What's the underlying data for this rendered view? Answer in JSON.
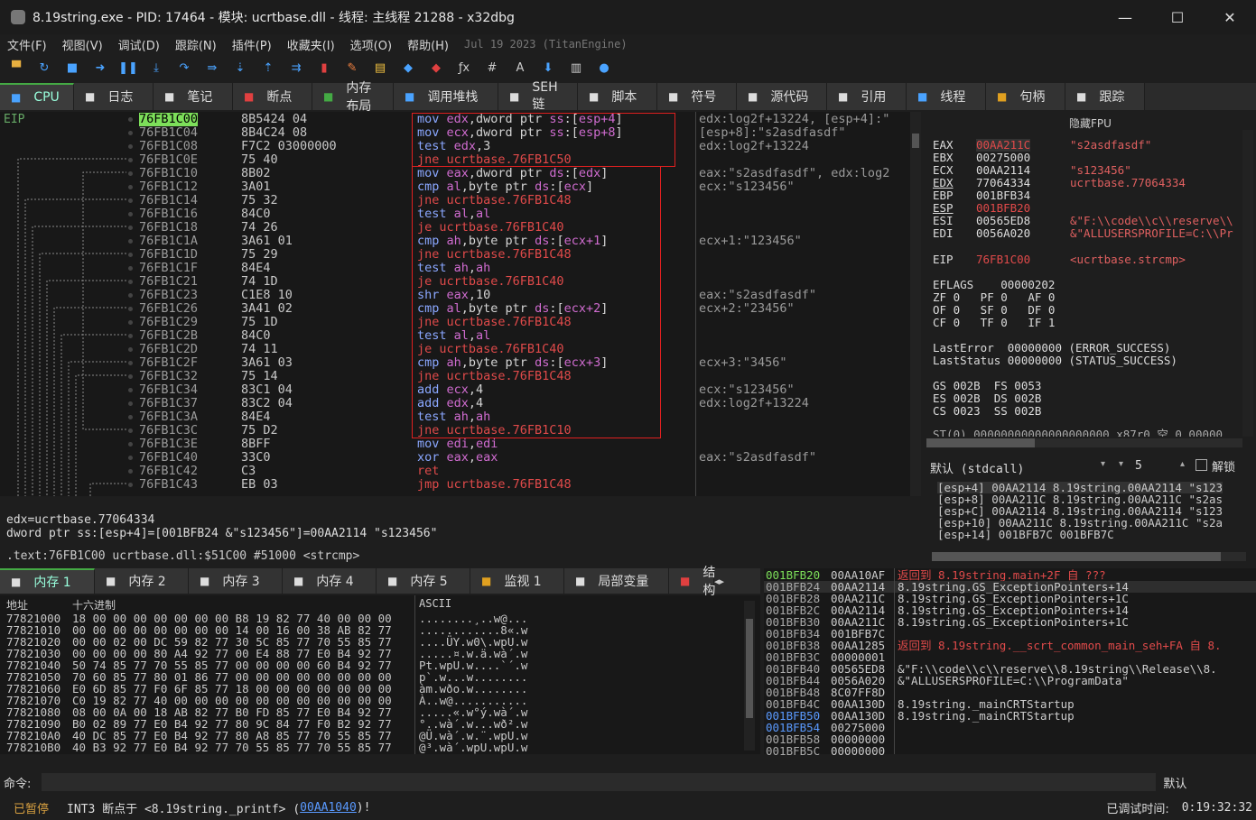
{
  "window": {
    "title": "8.19string.exe - PID: 17464 - 模块: ucrtbase.dll - 线程: 主线程 21288 - x32dbg"
  },
  "menu": [
    "文件(F)",
    "视图(V)",
    "调试(D)",
    "跟踪(N)",
    "插件(P)",
    "收藏夹(I)",
    "选项(O)",
    "帮助(H)"
  ],
  "menu_date": "Jul 19 2023 (TitanEngine)",
  "tabs": [
    "CPU",
    "日志",
    "笔记",
    "断点",
    "内存布局",
    "调用堆栈",
    "SEH链",
    "脚本",
    "符号",
    "源代码",
    "引用",
    "线程",
    "句柄",
    "跟踪"
  ],
  "tab_icons": [
    "cpu-icon",
    "log-icon",
    "notes-icon",
    "breakpoint-icon",
    "memory-map-icon",
    "callstack-icon",
    "seh-icon",
    "script-icon",
    "symbols-icon",
    "source-icon",
    "references-icon",
    "threads-icon",
    "handles-icon",
    "trace-icon"
  ],
  "cpu": {
    "eip_label": "EIP",
    "rows": [
      {
        "addr": "76FB1C00",
        "bytes": "8B5424 04",
        "asm": [
          [
            "kw",
            "mov "
          ],
          [
            "rg",
            "edx"
          ],
          [
            "",
            ","
          ],
          [
            "",
            "dword ptr "
          ],
          [
            "seg",
            "ss"
          ],
          [
            "",
            ":["
          ],
          [
            "rg",
            "esp+4"
          ],
          [
            "",
            "]"
          ]
        ],
        "cmt": "edx:log2f+13224, [esp+4]:\""
      },
      {
        "addr": "76FB1C04",
        "bytes": "8B4C24 08",
        "asm": [
          [
            "kw",
            "mov "
          ],
          [
            "rg",
            "ecx"
          ],
          [
            "",
            ",dword ptr "
          ],
          [
            "seg",
            "ss"
          ],
          [
            "",
            ":["
          ],
          [
            "rg",
            "esp+8"
          ],
          [
            "",
            "]"
          ]
        ],
        "cmt": "[esp+8]:\"s2asdfasdf\""
      },
      {
        "addr": "76FB1C08",
        "bytes": "F7C2 03000000",
        "asm": [
          [
            "kw",
            "test "
          ],
          [
            "rg",
            "edx"
          ],
          [
            "",
            ",3"
          ]
        ],
        "cmt": "edx:log2f+13224"
      },
      {
        "addr": "76FB1C0E",
        "bytes": "75 40",
        "asm": [
          [
            "jmp",
            "jne ucrtbase.76FB1C50"
          ]
        ],
        "cmt": ""
      },
      {
        "addr": "76FB1C10",
        "bytes": "8B02",
        "asm": [
          [
            "kw",
            "mov "
          ],
          [
            "rg",
            "eax"
          ],
          [
            "",
            ",dword ptr "
          ],
          [
            "seg",
            "ds"
          ],
          [
            "",
            ":["
          ],
          [
            "rg",
            "edx"
          ],
          [
            "",
            "]"
          ]
        ],
        "cmt": "eax:\"s2asdfasdf\", edx:log2"
      },
      {
        "addr": "76FB1C12",
        "bytes": "3A01",
        "asm": [
          [
            "kw",
            "cmp "
          ],
          [
            "rg",
            "al"
          ],
          [
            "",
            ",byte ptr "
          ],
          [
            "seg",
            "ds"
          ],
          [
            "",
            ":["
          ],
          [
            "rg",
            "ecx"
          ],
          [
            "",
            "]"
          ]
        ],
        "cmt": "ecx:\"s123456\""
      },
      {
        "addr": "76FB1C14",
        "bytes": "75 32",
        "asm": [
          [
            "jmp",
            "jne ucrtbase.76FB1C48"
          ]
        ],
        "cmt": ""
      },
      {
        "addr": "76FB1C16",
        "bytes": "84C0",
        "asm": [
          [
            "kw",
            "test "
          ],
          [
            "rg",
            "al"
          ],
          [
            "",
            ","
          ],
          [
            "rg",
            "al"
          ]
        ],
        "cmt": ""
      },
      {
        "addr": "76FB1C18",
        "bytes": "74 26",
        "asm": [
          [
            "jmp",
            "je ucrtbase.76FB1C40"
          ]
        ],
        "cmt": ""
      },
      {
        "addr": "76FB1C1A",
        "bytes": "3A61 01",
        "asm": [
          [
            "kw",
            "cmp "
          ],
          [
            "rg",
            "ah"
          ],
          [
            "",
            ",byte ptr "
          ],
          [
            "seg",
            "ds"
          ],
          [
            "",
            ":["
          ],
          [
            "rg",
            "ecx+1"
          ],
          [
            "",
            "]"
          ]
        ],
        "cmt": "ecx+1:\"123456\""
      },
      {
        "addr": "76FB1C1D",
        "bytes": "75 29",
        "asm": [
          [
            "jmp",
            "jne ucrtbase.76FB1C48"
          ]
        ],
        "cmt": ""
      },
      {
        "addr": "76FB1C1F",
        "bytes": "84E4",
        "asm": [
          [
            "kw",
            "test "
          ],
          [
            "rg",
            "ah"
          ],
          [
            "",
            ","
          ],
          [
            "rg",
            "ah"
          ]
        ],
        "cmt": ""
      },
      {
        "addr": "76FB1C21",
        "bytes": "74 1D",
        "asm": [
          [
            "jmp",
            "je ucrtbase.76FB1C40"
          ]
        ],
        "cmt": ""
      },
      {
        "addr": "76FB1C23",
        "bytes": "C1E8 10",
        "asm": [
          [
            "kw",
            "shr "
          ],
          [
            "rg",
            "eax"
          ],
          [
            "",
            ",10"
          ]
        ],
        "cmt": "eax:\"s2asdfasdf\""
      },
      {
        "addr": "76FB1C26",
        "bytes": "3A41 02",
        "asm": [
          [
            "kw",
            "cmp "
          ],
          [
            "rg",
            "al"
          ],
          [
            "",
            ",byte ptr "
          ],
          [
            "seg",
            "ds"
          ],
          [
            "",
            ":["
          ],
          [
            "rg",
            "ecx+2"
          ],
          [
            "",
            "]"
          ]
        ],
        "cmt": "ecx+2:\"23456\""
      },
      {
        "addr": "76FB1C29",
        "bytes": "75 1D",
        "asm": [
          [
            "jmp",
            "jne ucrtbase.76FB1C48"
          ]
        ],
        "cmt": ""
      },
      {
        "addr": "76FB1C2B",
        "bytes": "84C0",
        "asm": [
          [
            "kw",
            "test "
          ],
          [
            "rg",
            "al"
          ],
          [
            "",
            ","
          ],
          [
            "rg",
            "al"
          ]
        ],
        "cmt": ""
      },
      {
        "addr": "76FB1C2D",
        "bytes": "74 11",
        "asm": [
          [
            "jmp",
            "je ucrtbase.76FB1C40"
          ]
        ],
        "cmt": ""
      },
      {
        "addr": "76FB1C2F",
        "bytes": "3A61 03",
        "asm": [
          [
            "kw",
            "cmp "
          ],
          [
            "rg",
            "ah"
          ],
          [
            "",
            ",byte ptr "
          ],
          [
            "seg",
            "ds"
          ],
          [
            "",
            ":["
          ],
          [
            "rg",
            "ecx+3"
          ],
          [
            "",
            "]"
          ]
        ],
        "cmt": "ecx+3:\"3456\""
      },
      {
        "addr": "76FB1C32",
        "bytes": "75 14",
        "asm": [
          [
            "jmp",
            "jne ucrtbase.76FB1C48"
          ]
        ],
        "cmt": ""
      },
      {
        "addr": "76FB1C34",
        "bytes": "83C1 04",
        "asm": [
          [
            "kw",
            "add "
          ],
          [
            "rg",
            "ecx"
          ],
          [
            "",
            ",4"
          ]
        ],
        "cmt": "ecx:\"s123456\""
      },
      {
        "addr": "76FB1C37",
        "bytes": "83C2 04",
        "asm": [
          [
            "kw",
            "add "
          ],
          [
            "rg",
            "edx"
          ],
          [
            "",
            ",4"
          ]
        ],
        "cmt": "edx:log2f+13224"
      },
      {
        "addr": "76FB1C3A",
        "bytes": "84E4",
        "asm": [
          [
            "kw",
            "test "
          ],
          [
            "rg",
            "ah"
          ],
          [
            "",
            ","
          ],
          [
            "rg",
            "ah"
          ]
        ],
        "cmt": ""
      },
      {
        "addr": "76FB1C3C",
        "bytes": "75 D2",
        "asm": [
          [
            "jmp",
            "jne ucrtbase.76FB1C10"
          ]
        ],
        "cmt": ""
      },
      {
        "addr": "76FB1C3E",
        "bytes": "8BFF",
        "asm": [
          [
            "kw",
            "mov "
          ],
          [
            "rg",
            "edi"
          ],
          [
            "",
            ","
          ],
          [
            "rg",
            "edi"
          ]
        ],
        "cmt": ""
      },
      {
        "addr": "76FB1C40",
        "bytes": "33C0",
        "asm": [
          [
            "kw",
            "xor "
          ],
          [
            "rg",
            "eax"
          ],
          [
            "",
            ","
          ],
          [
            "rg",
            "eax"
          ]
        ],
        "cmt": "eax:\"s2asdfasdf\""
      },
      {
        "addr": "76FB1C42",
        "bytes": "C3",
        "asm": [
          [
            "jmp",
            "ret"
          ]
        ],
        "cmt": ""
      },
      {
        "addr": "76FB1C43",
        "bytes": "EB 03",
        "asm": [
          [
            "jmp",
            "jmp ucrtbase.76FB1C48"
          ]
        ],
        "cmt": ""
      }
    ]
  },
  "info": {
    "line1": "edx=ucrtbase.77064334",
    "line2": "dword ptr ss:[esp+4]=[001BFB24 &\"s123456\"]=00AA2114 \"s123456\"",
    "line3": ".text:76FB1C00 ucrtbase.dll:$51C00 #51000 <strcmp>"
  },
  "regs": {
    "header": "隐藏FPU",
    "gp": [
      {
        "name": "EAX",
        "val": "00AA211C",
        "cmt": "\"s2asdfasdf\""
      },
      {
        "name": "EBX",
        "val": "00275000",
        "cmt": ""
      },
      {
        "name": "ECX",
        "val": "00AA2114",
        "cmt": "\"s123456\""
      },
      {
        "name": "EDX",
        "val": "77064334",
        "cmt": "ucrtbase.77064334"
      },
      {
        "name": "EBP",
        "val": "001BFB34",
        "cmt": ""
      },
      {
        "name": "ESP",
        "val": "001BFB20",
        "cmt": ""
      },
      {
        "name": "ESI",
        "val": "00565ED8",
        "cmt": "&\"F:\\\\code\\\\c\\\\reserve\\\\"
      },
      {
        "name": "EDI",
        "val": "0056A020",
        "cmt": "&\"ALLUSERSPROFILE=C:\\\\Pr"
      }
    ],
    "eip": {
      "name": "EIP",
      "val": "76FB1C00",
      "cmt": "<ucrtbase.strcmp>"
    },
    "eflags": "EFLAGS    00000202",
    "flags": [
      "ZF 0   PF 0   AF 0",
      "OF 0   SF 0   DF 0",
      "CF 0   TF 0   IF 1"
    ],
    "lasterror": "LastError  00000000 (ERROR_SUCCESS)",
    "laststatus": "LastStatus 00000000 (STATUS_SUCCESS)",
    "seg": [
      "GS 002B  FS 0053",
      "ES 002B  DS 002B",
      "CS 0023  SS 002B"
    ],
    "st0": "ST(0) 00000000000000000000 x87r0 空 0.00000"
  },
  "args": {
    "callconv": "默认 (stdcall)",
    "count": "5",
    "unlock": "解锁",
    "rows": [
      "[esp+4] 00AA2114 8.19string.00AA2114 \"s123",
      "[esp+8] 00AA211C 8.19string.00AA211C \"s2as",
      "[esp+C] 00AA2114 8.19string.00AA2114 \"s123",
      "[esp+10] 00AA211C 8.19string.00AA211C \"s2a",
      "[esp+14] 001BFB7C 001BFB7C"
    ]
  },
  "memtabs": [
    "内存 1",
    "内存 2",
    "内存 3",
    "内存 4",
    "内存 5",
    "监视 1",
    "局部变量",
    "结构"
  ],
  "dump": {
    "hdr_addr": "地址",
    "hdr_hex": "十六进制",
    "hdr_ascii": "ASCII",
    "rows": [
      [
        "77821000",
        "18 00 00 00 00 00 00 00 B8 19 82 77 40 00 00 00",
        "........¸..w@..."
      ],
      [
        "77821010",
        "00 00 00 00 00 00 00 00 14 00 16 00 38 AB 82 77",
        "............8«.w"
      ],
      [
        "77821020",
        "00 00 02 00 DC 59 82 77 30 5C 85 77 70 55 85 77",
        "....ÜY.w0\\.wpU.w"
      ],
      [
        "77821030",
        "00 00 00 00 80 A4 92 77 00 E4 88 77 E0 B4 92 77",
        ".....¤.w.ä.wà´.w"
      ],
      [
        "77821040",
        "50 74 85 77 70 55 85 77 00 00 00 00 60 B4 92 77",
        "Pt.wpU.w....`´.w"
      ],
      [
        "77821050",
        "70 60 85 77 80 01 86 77 00 00 00 00 00 00 00 00",
        "p`.w...w........"
      ],
      [
        "77821060",
        "E0 6D 85 77 F0 6F 85 77 18 00 00 00 00 00 00 00",
        "àm.wðo.w........"
      ],
      [
        "77821070",
        "C0 19 82 77 40 00 00 00 00 00 00 00 00 00 00 00",
        "À..w@..........."
      ],
      [
        "77821080",
        "08 00 0A 00 18 AB 82 77 B0 FD 85 77 E0 B4 92 77",
        ".....«.w°ý.wà´.w"
      ],
      [
        "77821090",
        "B0 02 89 77 E0 B4 92 77 80 9C 84 77 F0 B2 92 77",
        "°..wà´.w...wð².w"
      ],
      [
        "778210A0",
        "40 DC 85 77 E0 B4 92 77 80 A8 85 77 70 55 85 77",
        "@Ü.wà´.w.¨.wpU.w"
      ],
      [
        "778210B0",
        "40 B3 92 77 E0 B4 92 77 70 55 85 77 70 55 85 77",
        "@³.wà´.wpU.wpU.w"
      ]
    ]
  },
  "stack": {
    "rows": [
      [
        "001BFB20",
        "00AA10AF",
        "返回到 8.19string.main+2F 自 ???"
      ],
      [
        "001BFB24",
        "00AA2114",
        "8.19string.GS_ExceptionPointers+14"
      ],
      [
        "001BFB28",
        "00AA211C",
        "8.19string.GS_ExceptionPointers+1C"
      ],
      [
        "001BFB2C",
        "00AA2114",
        "8.19string.GS_ExceptionPointers+14"
      ],
      [
        "001BFB30",
        "00AA211C",
        "8.19string.GS_ExceptionPointers+1C"
      ],
      [
        "001BFB34",
        "001BFB7C",
        ""
      ],
      [
        "001BFB38",
        "00AA1285",
        "返回到 8.19string.__scrt_common_main_seh+FA 自 8."
      ],
      [
        "001BFB3C",
        "00000001",
        ""
      ],
      [
        "001BFB40",
        "00565ED8",
        "&\"F:\\\\code\\\\c\\\\reserve\\\\8.19string\\\\Release\\\\8."
      ],
      [
        "001BFB44",
        "0056A020",
        "&\"ALLUSERSPROFILE=C:\\\\ProgramData\""
      ],
      [
        "001BFB48",
        "8C07FF8D",
        ""
      ],
      [
        "001BFB4C",
        "00AA130D",
        "8.19string._mainCRTStartup"
      ],
      [
        "001BFB50",
        "00AA130D",
        "8.19string._mainCRTStartup"
      ],
      [
        "001BFB54",
        "00275000",
        ""
      ],
      [
        "001BFB58",
        "00000000",
        ""
      ],
      [
        "001BFB5C",
        "00000000",
        ""
      ]
    ]
  },
  "cmd": {
    "label": "命令:",
    "default": "默认"
  },
  "status": {
    "state": "已暂停",
    "int3": "INT3  断点于 <8.19string._printf> (",
    "addr": "00AA1040",
    "tail": ")!",
    "debug_time_label": "已调试时间:",
    "debug_time": "0:19:32:32"
  }
}
